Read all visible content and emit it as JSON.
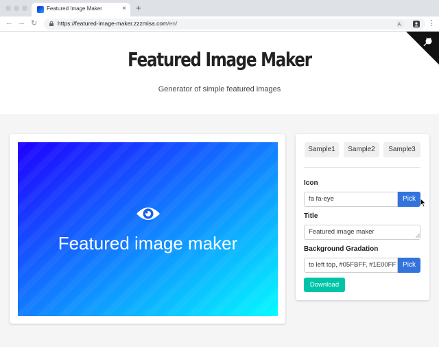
{
  "browser": {
    "tab_title": "Featured Image Maker",
    "tab_close": "×",
    "new_tab": "+",
    "url_host": "https://featured-image-maker.zzzmisa.com",
    "url_path": "/en/",
    "back": "←",
    "forward": "→",
    "reload": "↻",
    "menu": "⋮"
  },
  "hero": {
    "title": "Featured Image Maker",
    "subtitle": "Generator of simple featured images"
  },
  "preview": {
    "icon": "eye-icon",
    "title": "Featured image maker",
    "gradient_from": "#05FBFF",
    "gradient_to": "#1E00FF"
  },
  "form": {
    "samples": [
      "Sample1",
      "Sample2",
      "Sample3"
    ],
    "icon_label": "Icon",
    "icon_value": "fa fa-eye",
    "pick_label": "Pick",
    "title_label": "Title",
    "title_value": "Featured image maker",
    "gradation_label": "Background Gradation",
    "gradation_value": "to left top, #05FBFF, #1E00FF",
    "download_label": "Download"
  },
  "colors": {
    "pick_button": "#3273dc",
    "download_button": "#00c4a7"
  }
}
